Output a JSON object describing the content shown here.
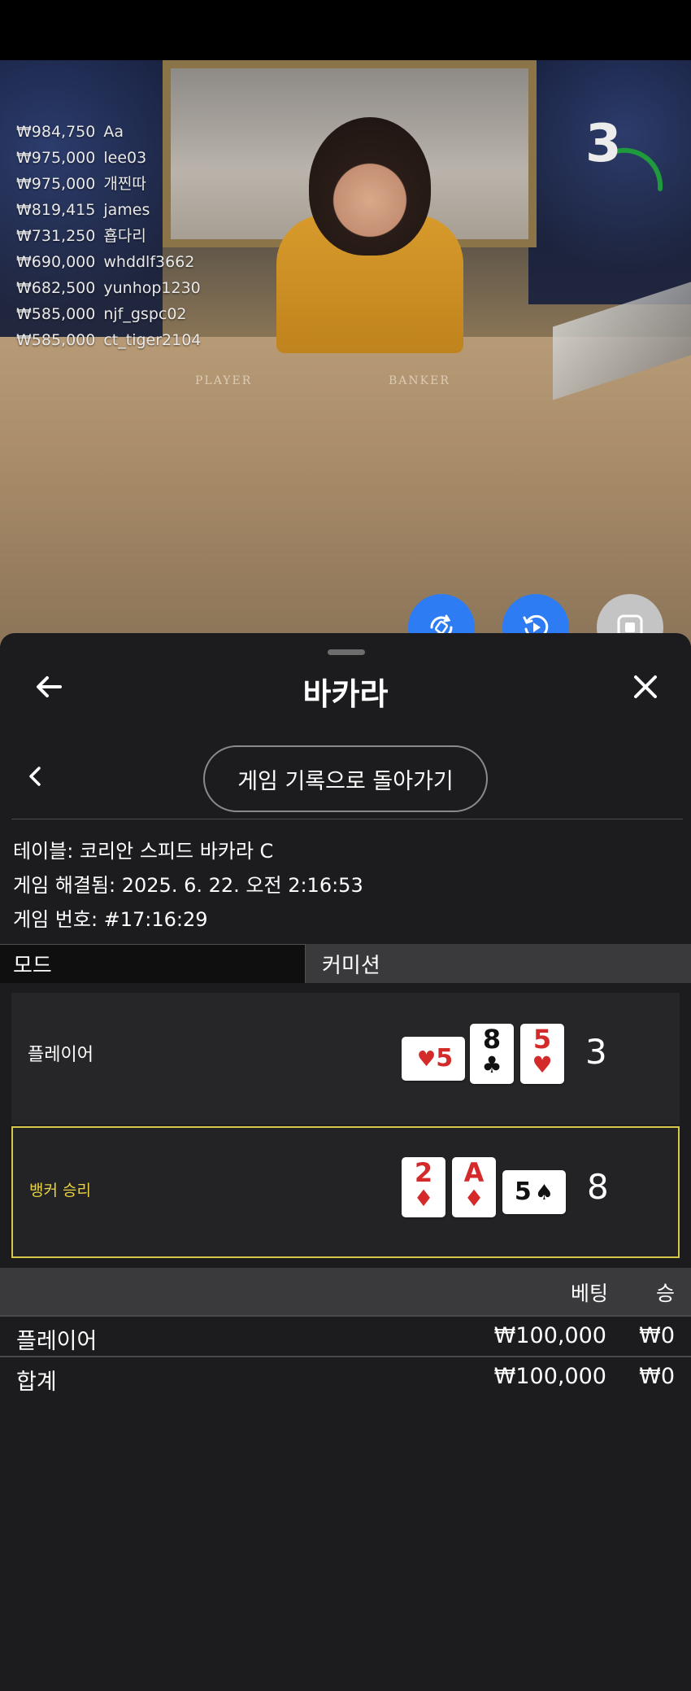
{
  "leaderboard": [
    {
      "amount": "₩984,750",
      "name": "Aa"
    },
    {
      "amount": "₩975,000",
      "name": "lee03"
    },
    {
      "amount": "₩975,000",
      "name": "개찐따"
    },
    {
      "amount": "₩819,415",
      "name": "james"
    },
    {
      "amount": "₩731,250",
      "name": "횹다리"
    },
    {
      "amount": "₩690,000",
      "name": "whddlf3662"
    },
    {
      "amount": "₩682,500",
      "name": "yunhop1230"
    },
    {
      "amount": "₩585,000",
      "name": "njf_gspc02"
    },
    {
      "amount": "₩585,000",
      "name": "ct_tiger2104"
    }
  ],
  "countdown": "3",
  "table_labels": {
    "player": "PLAYER",
    "banker": "BANKER"
  },
  "sheet": {
    "title": "바카라",
    "back_to_history": "게임 기록으로 돌아가기"
  },
  "info": {
    "table": "테이블: 코리안 스피드 바카라 C",
    "resolved": "게임 해결됨: 2025. 6. 22. 오전 2:16:53",
    "game_number": "게임 번호: #17:16:29"
  },
  "tabs": {
    "mode": "모드",
    "commission": "커미션"
  },
  "hands": {
    "player": {
      "label": "플레이어",
      "score": "3",
      "cards": [
        {
          "rank": "5",
          "suit": "♥",
          "color": "red",
          "orientation": "horizontal"
        },
        {
          "rank": "8",
          "suit": "♣",
          "color": "black",
          "orientation": "vertical"
        },
        {
          "rank": "5",
          "suit": "♥",
          "color": "red",
          "orientation": "vertical"
        }
      ]
    },
    "banker": {
      "label": "뱅커 승리",
      "score": "8",
      "cards": [
        {
          "rank": "2",
          "suit": "♦",
          "color": "red",
          "orientation": "vertical"
        },
        {
          "rank": "A",
          "suit": "♦",
          "color": "red",
          "orientation": "vertical"
        },
        {
          "rank": "5",
          "suit": "♠",
          "color": "black",
          "orientation": "horizontal"
        }
      ]
    }
  },
  "bets": {
    "col_bet": "베팅",
    "col_win": "승",
    "rows": [
      {
        "name": "플레이어",
        "bet": "₩100,000",
        "win": "₩0"
      },
      {
        "name": "합계",
        "bet": "₩100,000",
        "win": "₩0"
      }
    ]
  },
  "colors": {
    "accent_blue": "#2d7cf4",
    "win_gold": "#d6c84a",
    "sheet_bg": "#1c1c1e"
  }
}
